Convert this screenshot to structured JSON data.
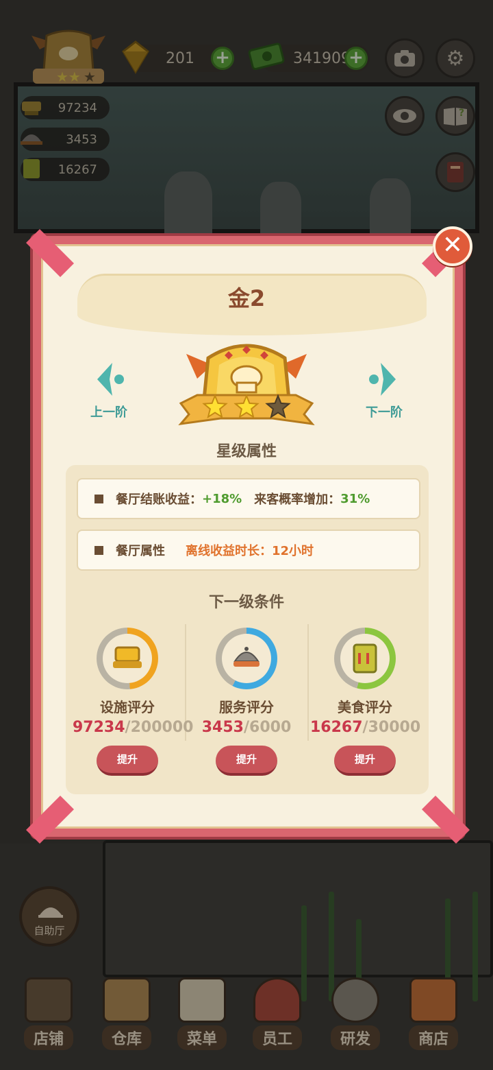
{
  "hud": {
    "gems": "201",
    "cash": "341909",
    "facility_score": "97234",
    "service_score": "3453",
    "food_score": "16267"
  },
  "modal": {
    "title": "金2",
    "prev_label": "上一阶",
    "next_label": "下一阶",
    "stars_filled": 2,
    "stars_total": 3,
    "star_section": "星级属性",
    "attr1": {
      "label1": "餐厅结账收益：",
      "value1": "+18%",
      "label2": "来客概率增加：",
      "value2": "31%"
    },
    "attr2": {
      "label1": "餐厅属性",
      "label2": "离线收益时长：",
      "value2": "12小时"
    },
    "next_section": "下一级条件",
    "conditions": [
      {
        "name": "设施评分",
        "current": "97234",
        "target": "/200000",
        "button": "提升",
        "ring_color": "#f0a31f",
        "progress": 0.486
      },
      {
        "name": "服务评分",
        "current": "3453",
        "target": "/6000",
        "button": "提升",
        "ring_color": "#3fa9e0",
        "progress": 0.576
      },
      {
        "name": "美食评分",
        "current": "16267",
        "target": "/30000",
        "button": "提升",
        "ring_color": "#8cc63f",
        "progress": 0.542
      }
    ]
  },
  "buffet_label": "自助厅",
  "nav": [
    "店铺",
    "仓库",
    "菜单",
    "员工",
    "研发",
    "商店"
  ]
}
